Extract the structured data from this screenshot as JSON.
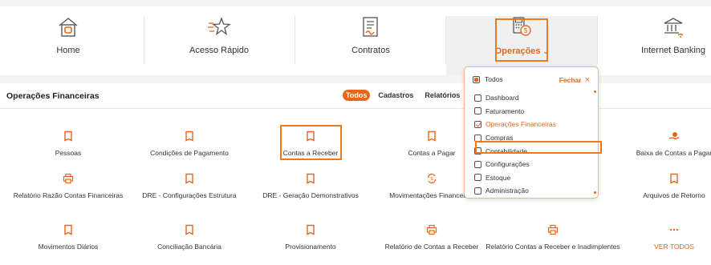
{
  "nav": {
    "home_label": "Home",
    "quick_label": "Acesso Rápido",
    "contracts_label": "Contratos",
    "ops_label": "Operações",
    "banking_label": "Internet Banking"
  },
  "panel": {
    "title": "Operações Financeiras",
    "filters": [
      "Todos",
      "Cadastros",
      "Relatórios"
    ]
  },
  "tiles": [
    "Pessoas",
    "Condições de Pagamento",
    "Contas a Receber",
    "Contas a Pagar",
    "Baixa de Contas a Pagar",
    "Relatório Razão Contas Financeiras",
    "DRE - Configurações Estrutura",
    "DRE - Geração Demonstrativos",
    "Movimentações Financeiras",
    "Arquivos de Retorno",
    "Movimentos Diários",
    "Conciliação Bancária",
    "Provisionamento",
    "Relatório de Contas a Receber",
    "Relatório Contas a Receber e Inadimplentes",
    "VER TODOS"
  ],
  "dropdown": {
    "all_label": "Todos",
    "close_label": "Fechar",
    "options": [
      "Dashboard",
      "Faturamento",
      "Operações Financeiras",
      "Compras",
      "Contabilidade",
      "Configurações",
      "Estoque",
      "Administração"
    ],
    "checked_option": "Operações Financeiras"
  },
  "colors": {
    "accent": "#e8661a"
  }
}
